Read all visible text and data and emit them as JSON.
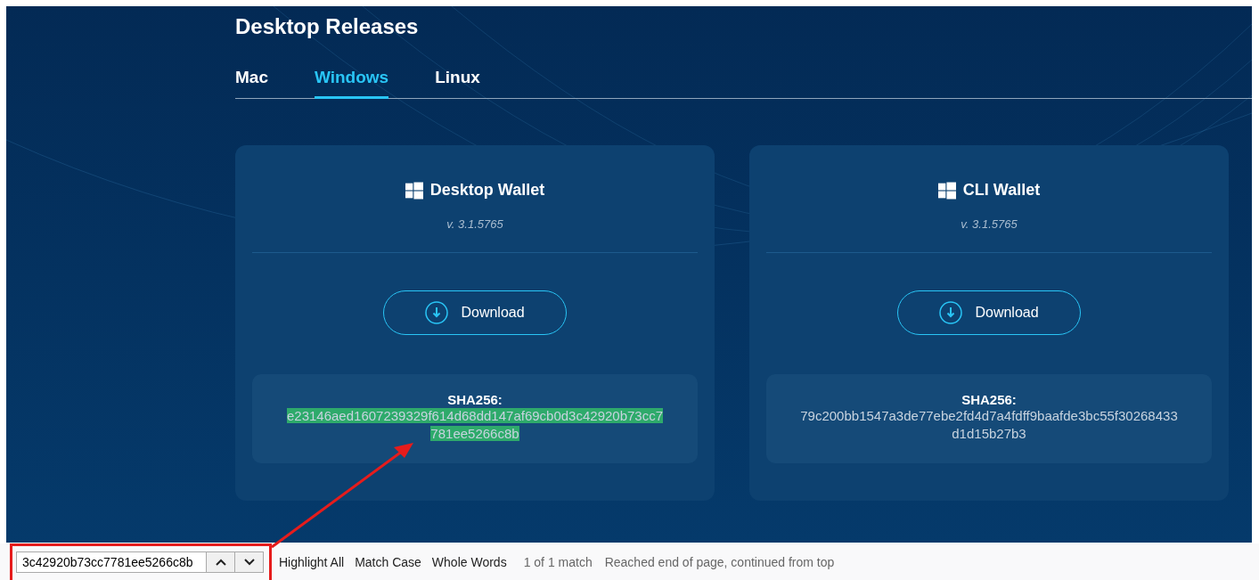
{
  "page": {
    "title": "Desktop Releases"
  },
  "tabs": [
    {
      "label": "Mac",
      "selected": false
    },
    {
      "label": "Windows",
      "selected": true
    },
    {
      "label": "Linux",
      "selected": false
    }
  ],
  "cards": [
    {
      "title": "Desktop Wallet",
      "version": "v. 3.1.5765",
      "button": "Download",
      "hash_label": "SHA256:",
      "hash": "e23146aed1607239329f614d68dd147af69cb0d3c42920b73cc7781ee5266c8b",
      "highlighted": true
    },
    {
      "title": "CLI Wallet",
      "version": "v. 3.1.5765",
      "button": "Download",
      "hash_label": "SHA256:",
      "hash": "79c200bb1547a3de77ebe2fd4d7a4fdff9baafde3bc55f30268433d1d15b27b3",
      "highlighted": false
    }
  ],
  "find_bar": {
    "value": "3c42920b73cc7781ee5266c8b",
    "options": [
      "Highlight All",
      "Match Case",
      "Whole Words"
    ],
    "result": "1 of 1 match",
    "status": "Reached end of page, continued from top"
  }
}
